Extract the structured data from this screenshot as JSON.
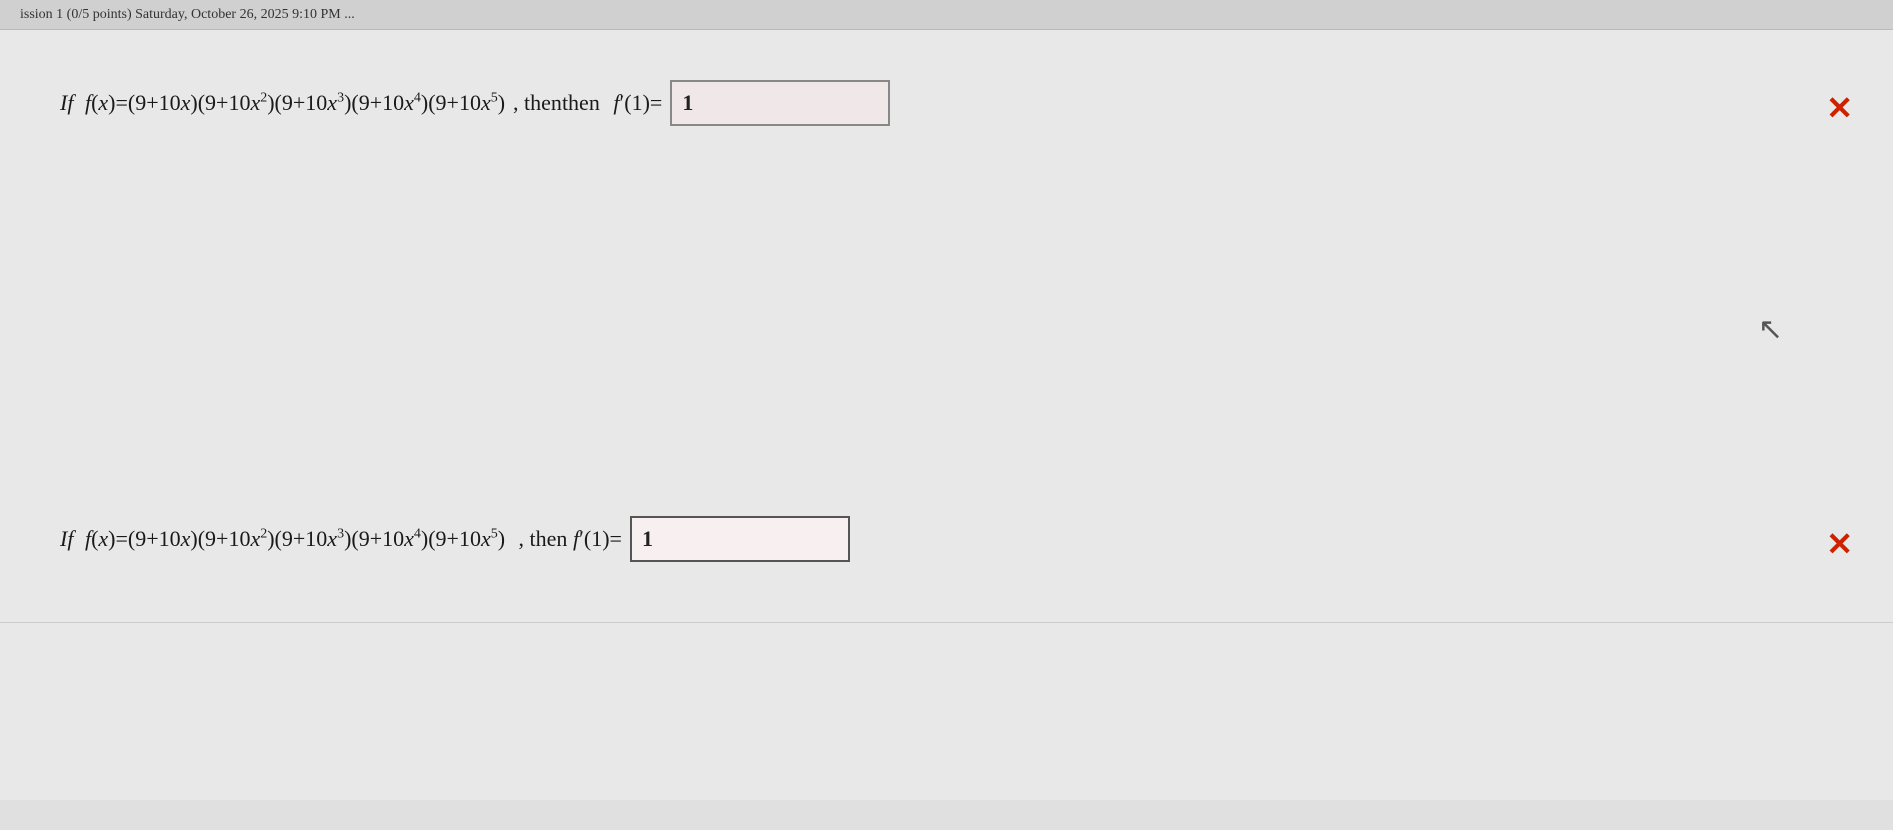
{
  "header": {
    "text": "ission 1  (0/5 points)  Saturday, October 26, 2025  9:10 PM  ..."
  },
  "question1": {
    "if_label": "If",
    "expression": "f(x)=(9+10x)(9+10x²)(9+10x³)(9+10x⁴)(9+10x⁵)",
    "then_label": ", then",
    "fprime_label": "f′(1)=",
    "answer": "1",
    "answer_box_bg": "#f5e8e8"
  },
  "question2": {
    "if_label": "If",
    "expression": "f(x)=(9+10x)(9+10x²)(9+10x³)(9+10x⁴)(9+10x⁵)",
    "then_label": ", then",
    "fprime_label": "f′(1)=",
    "answer": "1",
    "answer_box_bg": "#f8f8f8"
  },
  "icons": {
    "close": "✕",
    "cursor": "↖"
  }
}
